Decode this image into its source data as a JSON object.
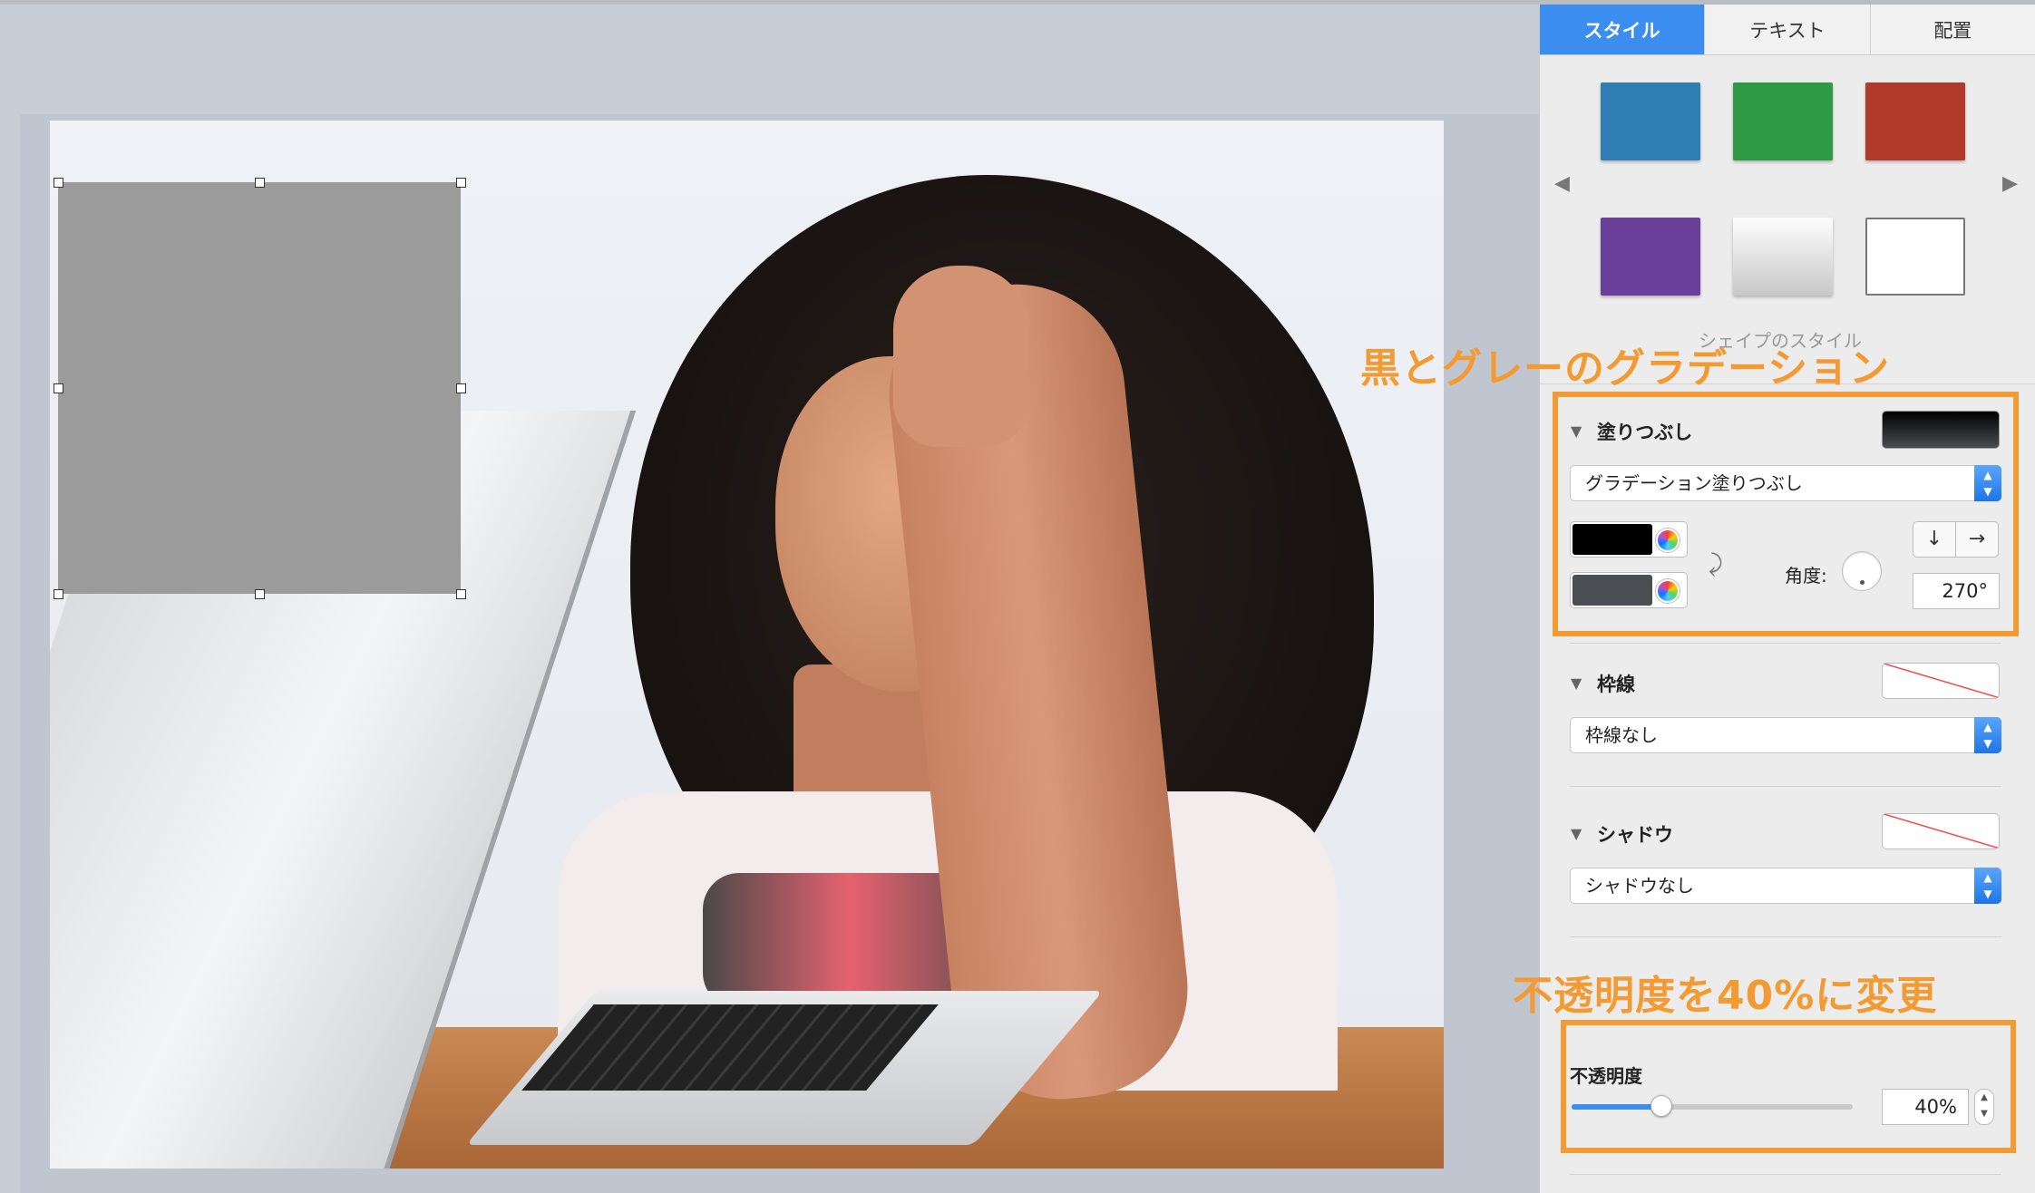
{
  "tabs": [
    {
      "label": "スタイル",
      "active": true
    },
    {
      "label": "テキスト",
      "active": false
    },
    {
      "label": "配置",
      "active": false
    }
  ],
  "swatches": [
    {
      "name": "blue",
      "color": "#2f7fb5"
    },
    {
      "name": "green",
      "color": "#2f9a44"
    },
    {
      "name": "red",
      "color": "#b23a2a"
    },
    {
      "name": "purple",
      "color": "#6a3f9a"
    },
    {
      "name": "light-gray-gradient",
      "color": "#d4d4d4"
    },
    {
      "name": "white-outline",
      "color": "#ffffff"
    }
  ],
  "shape_styles_label": "シェイプのスタイル",
  "annotations": {
    "gradient_callout": "黒とグレーのグラデーション",
    "opacity_callout": "不透明度を40%に変更"
  },
  "fill": {
    "title": "塗りつぶし",
    "type": "グラデーション塗りつぶし",
    "color1": "#000000",
    "color2": "#4a4d52",
    "angle_label": "角度:",
    "angle_value": "270°"
  },
  "border": {
    "title": "枠線",
    "type": "枠線なし"
  },
  "shadow": {
    "title": "シャドウ",
    "type": "シャドウなし"
  },
  "opacity": {
    "title": "不透明度",
    "value": "40%",
    "fraction": 0.4
  },
  "accent_color": "#f39a33",
  "tab_active_color": "#3b8ef0"
}
